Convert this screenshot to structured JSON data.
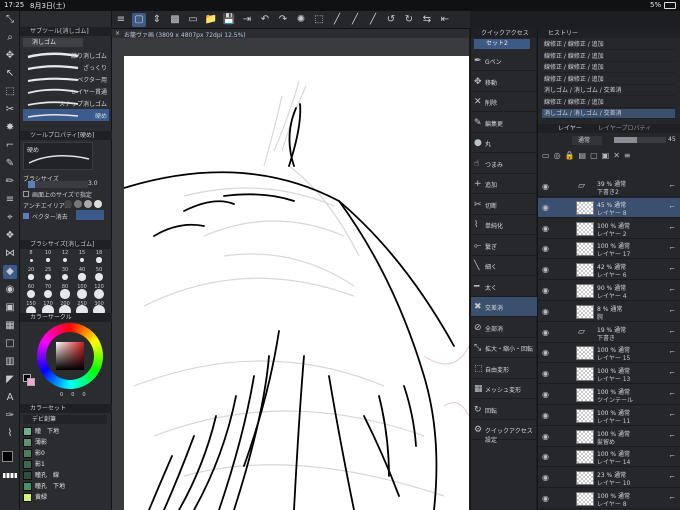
{
  "status": {
    "time": "17:25",
    "date": "8月3日(土)",
    "battery": "5%"
  },
  "command_bar": {
    "items": [
      "≡",
      "▢",
      "⇕",
      "▩",
      "▭",
      "📁",
      "💾",
      "⇥",
      "↶",
      "↷",
      "✺",
      "⬚",
      "╱",
      "╱",
      "╱",
      "↺",
      "↻",
      "⇆",
      "⇤"
    ]
  },
  "document_tab": {
    "title": "お籠ヴァ画 (3809 x 4807px 72dpi 12.5%)",
    "close": "×"
  },
  "sub_tool": {
    "header": "サブツール[消しゴム]",
    "tab": "消しゴム",
    "brushes": [
      "練り消しゴム",
      "ざっくり",
      "ベクター用",
      "レイヤー貫通",
      "スナップ消しゴム",
      "硬め"
    ],
    "selected_index": 5
  },
  "tool_property": {
    "header": "ツールプロパティ[硬め]",
    "preset": "硬め",
    "size_label": "ブラシサイズ",
    "size_value": "3.0",
    "canvas_size_label": "画面上のサイズで指定",
    "antialias_label": "アンチエイリアス",
    "vector_erase_label": "ベクター消去"
  },
  "brush_size": {
    "header": "ブラシサイズ[消しゴム]",
    "sizes": [
      "8",
      "10",
      "12",
      "15",
      "18",
      "20",
      "25",
      "30",
      "40",
      "50",
      "60",
      "70",
      "80",
      "100",
      "120",
      "150",
      "170",
      "200",
      "250",
      "300"
    ]
  },
  "color_circle": {
    "header": "カラーサークル",
    "values": [
      "0",
      "0",
      "0"
    ]
  },
  "color_set": {
    "header": "カラーセット",
    "preset": "デビ創筆",
    "swatches": [
      {
        "label": "瞳　下地",
        "color": "#6fae8a"
      },
      {
        "label": "薄影",
        "color": "#5f8f75"
      },
      {
        "label": "影0",
        "color": "#4e7a5f"
      },
      {
        "label": "影1",
        "color": "#3e6650"
      },
      {
        "label": "瞳孔　線",
        "color": "#2e4f3d"
      },
      {
        "label": "瞳孔　下地",
        "color": "#4b8f6a"
      },
      {
        "label": "黄緑",
        "color": "#d5f07a"
      }
    ]
  },
  "quick_access": {
    "header": "クイックアクセス",
    "set_label": "セット2",
    "items": [
      "Gペン",
      "移動",
      "削除",
      "編集更",
      "丸",
      "つまみ",
      "追加",
      "切断",
      "単純化",
      "繋ぎ",
      "細く",
      "太く",
      "交差消",
      "全部消",
      "拡大・縮小・回転",
      "自由変形",
      "メッシュ変形",
      "回転",
      "クイックアクセス設定"
    ],
    "selected_index": 12
  },
  "history": {
    "header": "ヒストリー",
    "items": [
      "線修正 / 線修正 / 追加",
      "線修正 / 線修正 / 追加",
      "線修正 / 線修正 / 追加",
      "線修正 / 線修正 / 追加",
      "消しゴム / 消しゴム / 交差消",
      "線修正 / 線修正 / 追加",
      "消しゴム / 消しゴム / 交差消"
    ],
    "selected_index": 6
  },
  "layers": {
    "header": "レイヤー",
    "header2": "レイヤープロパティ",
    "blend": "通常",
    "opacity": "45",
    "rows": [
      {
        "pct": "39 % 通常",
        "name": "下書き2",
        "folder": true
      },
      {
        "pct": "45 % 通常",
        "name": "レイヤー 8",
        "selected": true
      },
      {
        "pct": "100 % 通常",
        "name": "レイヤー 2"
      },
      {
        "pct": "100 % 通常",
        "name": "レイヤー 17"
      },
      {
        "pct": "42 % 通常",
        "name": "レイヤー 6"
      },
      {
        "pct": "90 % 通常",
        "name": "レイヤー 4"
      },
      {
        "pct": "8 % 通常",
        "name": "腕"
      },
      {
        "pct": "19 % 通常",
        "name": "下書き",
        "folder": true
      },
      {
        "pct": "100 % 通常",
        "name": "レイヤー 15"
      },
      {
        "pct": "100 % 通常",
        "name": "レイヤー 13"
      },
      {
        "pct": "100 % 通常",
        "name": "ツインテール"
      },
      {
        "pct": "100 % 通常",
        "name": "レイヤー 11"
      },
      {
        "pct": "100 % 通常",
        "name": "髪留め"
      },
      {
        "pct": "100 % 通常",
        "name": "レイヤー 14"
      },
      {
        "pct": "23 % 通常",
        "name": "レイヤー 10"
      },
      {
        "pct": "100 % 通常",
        "name": "レイヤー 8"
      }
    ]
  }
}
